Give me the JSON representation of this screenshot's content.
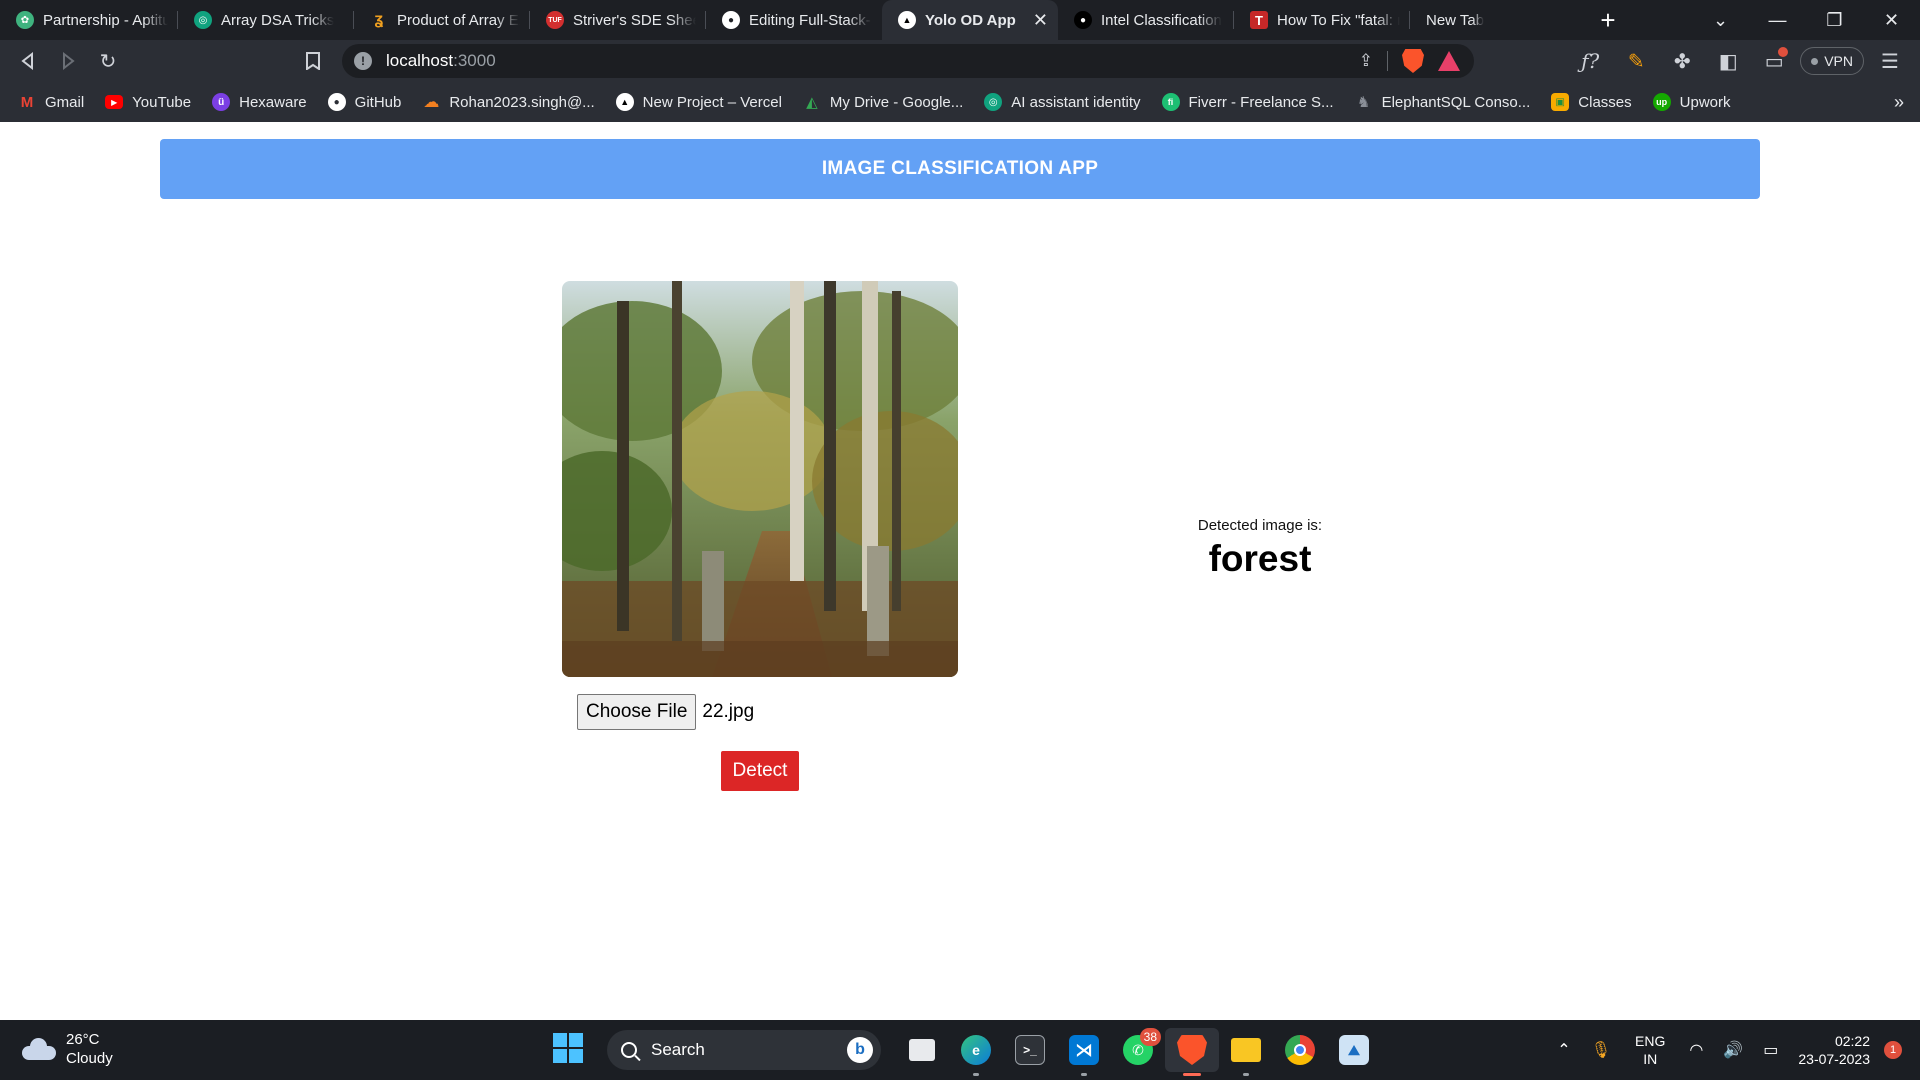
{
  "browser": {
    "tabs": [
      {
        "title": "Partnership - Aptitu",
        "icon": "aptitude-icon",
        "color": "#3fb37f"
      },
      {
        "title": "Array DSA Tricks",
        "icon": "chatgpt-icon",
        "color": "#10a37f"
      },
      {
        "title": "Product of Array Ex",
        "icon": "leetcode-icon",
        "color": "#f0a020"
      },
      {
        "title": "Striver's SDE Sheet",
        "icon": "tuf-icon",
        "color": "#d32f2f"
      },
      {
        "title": "Editing Full-Stack-N",
        "icon": "github-icon",
        "color": "#ffffff"
      },
      {
        "title": "Yolo OD App",
        "icon": "vercel-icon",
        "color": "#ffffff",
        "active": true
      },
      {
        "title": "Intel Classification",
        "icon": "github-dark-icon",
        "color": "#000000"
      },
      {
        "title": "How To Fix \"fatal: n",
        "icon": "t-icon",
        "color": "#c62828"
      },
      {
        "title": "New Tab",
        "icon": "",
        "color": ""
      }
    ],
    "url_host": "localhost",
    "url_port": ":3000",
    "vpn_label": "VPN",
    "bookmarks": [
      {
        "label": "Gmail",
        "icon": "gmail-icon",
        "color": "#ea4335"
      },
      {
        "label": "YouTube",
        "icon": "youtube-icon",
        "color": "#ff0000"
      },
      {
        "label": "Hexaware",
        "icon": "hexaware-icon",
        "color": "#7b3fe4"
      },
      {
        "label": "GitHub",
        "icon": "github-icon",
        "color": "#ffffff"
      },
      {
        "label": "Rohan2023.singh@...",
        "icon": "cloud-icon",
        "color": "#f38020"
      },
      {
        "label": "New Project – Vercel",
        "icon": "vercel-icon",
        "color": "#ffffff"
      },
      {
        "label": "My Drive - Google...",
        "icon": "drive-icon",
        "color": "#34a853"
      },
      {
        "label": "AI assistant identity",
        "icon": "chatgpt-icon",
        "color": "#10a37f"
      },
      {
        "label": "Fiverr - Freelance S...",
        "icon": "fiverr-icon",
        "color": "#1dbf73"
      },
      {
        "label": "ElephantSQL Conso...",
        "icon": "elephant-icon",
        "color": "#8a8f98"
      },
      {
        "label": "Classes",
        "icon": "classroom-icon",
        "color": "#f9ab00"
      },
      {
        "label": "Upwork",
        "icon": "upwork-icon",
        "color": "#14a800"
      }
    ]
  },
  "app": {
    "header_title": "IMAGE CLASSIFICATION APP",
    "choose_file_label": "Choose File",
    "file_name": "22.jpg",
    "detect_label": "Detect",
    "result_label": "Detected image is:",
    "result_value": "forest"
  },
  "taskbar": {
    "weather_temp": "26°C",
    "weather_desc": "Cloudy",
    "search_label": "Search",
    "whatsapp_badge": "38",
    "lang_1": "ENG",
    "lang_2": "IN",
    "time": "02:22",
    "date": "23-07-2023",
    "notification_count": "1"
  },
  "colors": {
    "header_bg": "#63a1f5",
    "detect_bg": "#dc2626",
    "taskbar_bg": "#1b1e23"
  }
}
